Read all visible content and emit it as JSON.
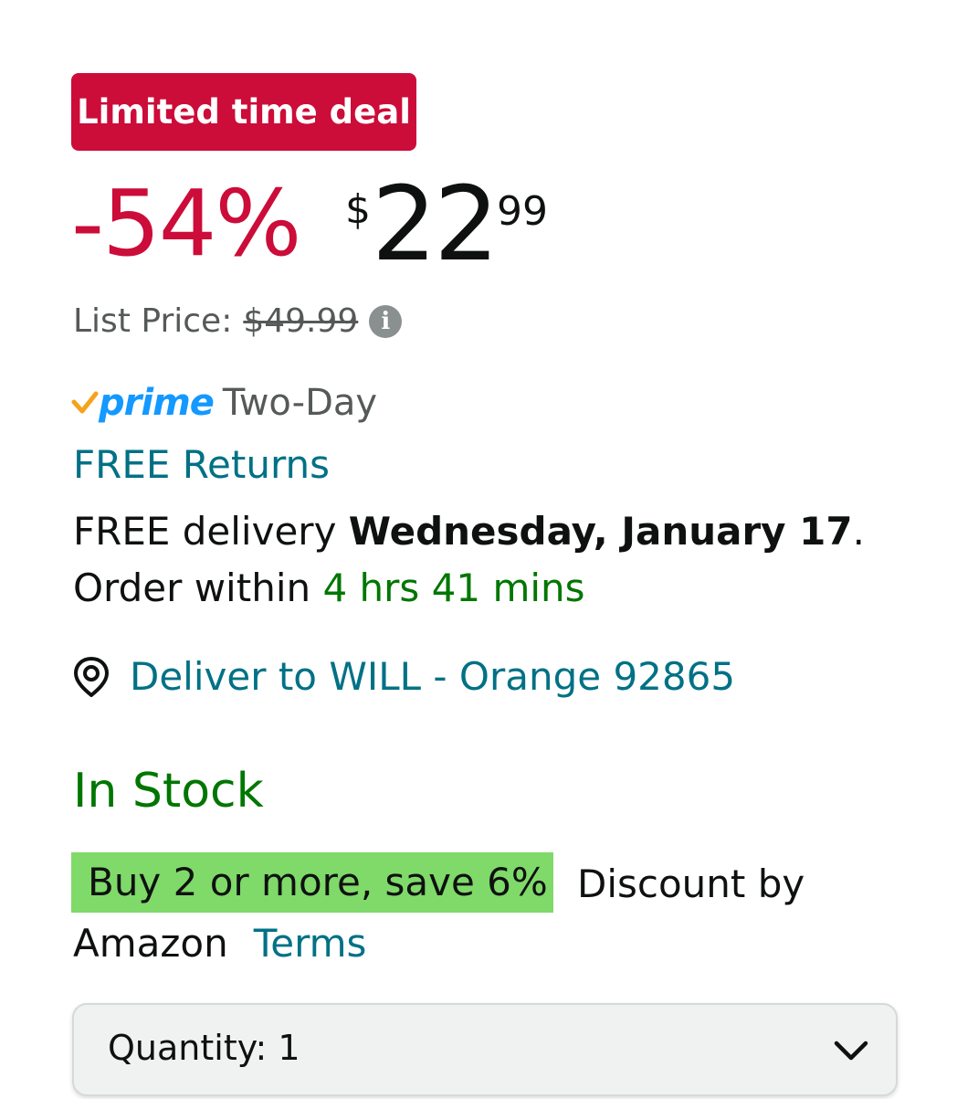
{
  "deal_badge": {
    "label": "Limited time deal",
    "color": "#cc0c39"
  },
  "price": {
    "discount": "-54%",
    "currency_symbol": "$",
    "whole": "22",
    "fraction": "99",
    "list_price_label": "List Price:",
    "list_price_value": "$49.99",
    "info_icon": "info-icon"
  },
  "prime": {
    "check_icon": "prime-check-icon",
    "word": "prime",
    "detail": "Two-Day"
  },
  "free_returns": "FREE Returns",
  "delivery": {
    "prefix": "FREE delivery",
    "date": "Wednesday, January 17",
    "suffix": ".",
    "order_within_label": "Order within",
    "countdown": "4 hrs 41 mins"
  },
  "deliver_to": {
    "icon": "location-pin-icon",
    "label": "Deliver to WILL - Orange 92865"
  },
  "stock_status": "In Stock",
  "promotion": {
    "badge": "Buy 2 or more, save 6%",
    "text_part1": "Discount by",
    "text_part2": "Amazon",
    "terms_link": "Terms",
    "badge_color": "#7fda69"
  },
  "quantity": {
    "label": "Quantity:",
    "value": "1",
    "chevron_icon": "chevron-down-icon"
  },
  "colors": {
    "deal_red": "#cc0c39",
    "link_teal": "#007185",
    "success_green": "#007600",
    "prime_blue": "#1399ff",
    "prime_check_orange": "#f7a21c"
  }
}
